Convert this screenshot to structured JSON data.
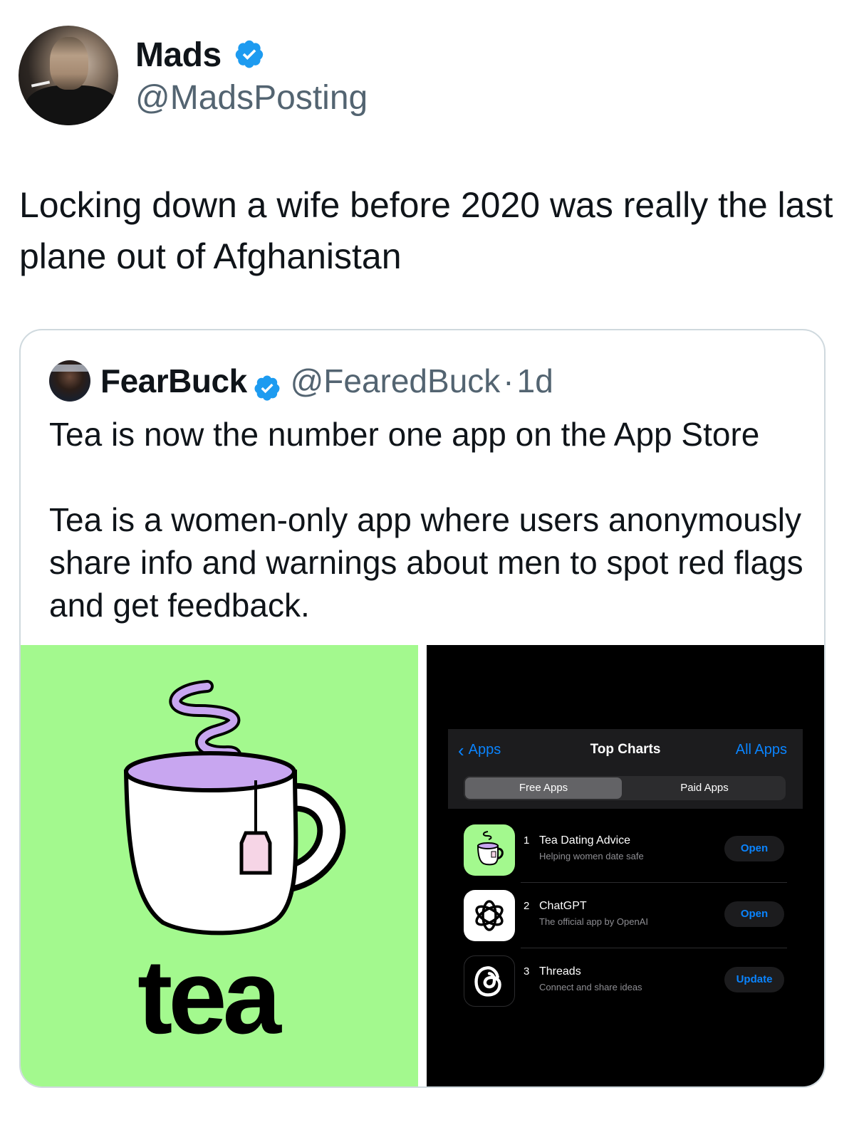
{
  "tweet": {
    "display_name": "Mads",
    "handle": "@MadsPosting",
    "text": "Locking down a wife before 2020 was really the last plane out of Afghanistan",
    "verified_color": "#1d9bf0"
  },
  "quote": {
    "display_name": "FearBuck",
    "handle": "@FearedBuck",
    "separator": "·",
    "time": "1d",
    "text": "Tea is now the number one app on the App Store\n\nTea is a women-only app where users anonymously share info and warnings about men to spot red flags and get feedback.",
    "media": {
      "left": {
        "logo_text": "tea",
        "background": "#a3f98e"
      },
      "right": {
        "back_label": "Apps",
        "title": "Top Charts",
        "all_label": "All Apps",
        "segments": [
          "Free Apps",
          "Paid Apps"
        ],
        "selected_segment": "Free Apps",
        "apps": [
          {
            "rank": "1",
            "name": "Tea Dating Advice",
            "subtitle": "Helping women date safe",
            "button": "Open",
            "icon": "tea-cup-icon"
          },
          {
            "rank": "2",
            "name": "ChatGPT",
            "subtitle": "The official app by OpenAI",
            "button": "Open",
            "icon": "openai-icon"
          },
          {
            "rank": "3",
            "name": "Threads",
            "subtitle": "Connect and share ideas",
            "button": "Update",
            "icon": "threads-icon"
          }
        ]
      }
    }
  }
}
